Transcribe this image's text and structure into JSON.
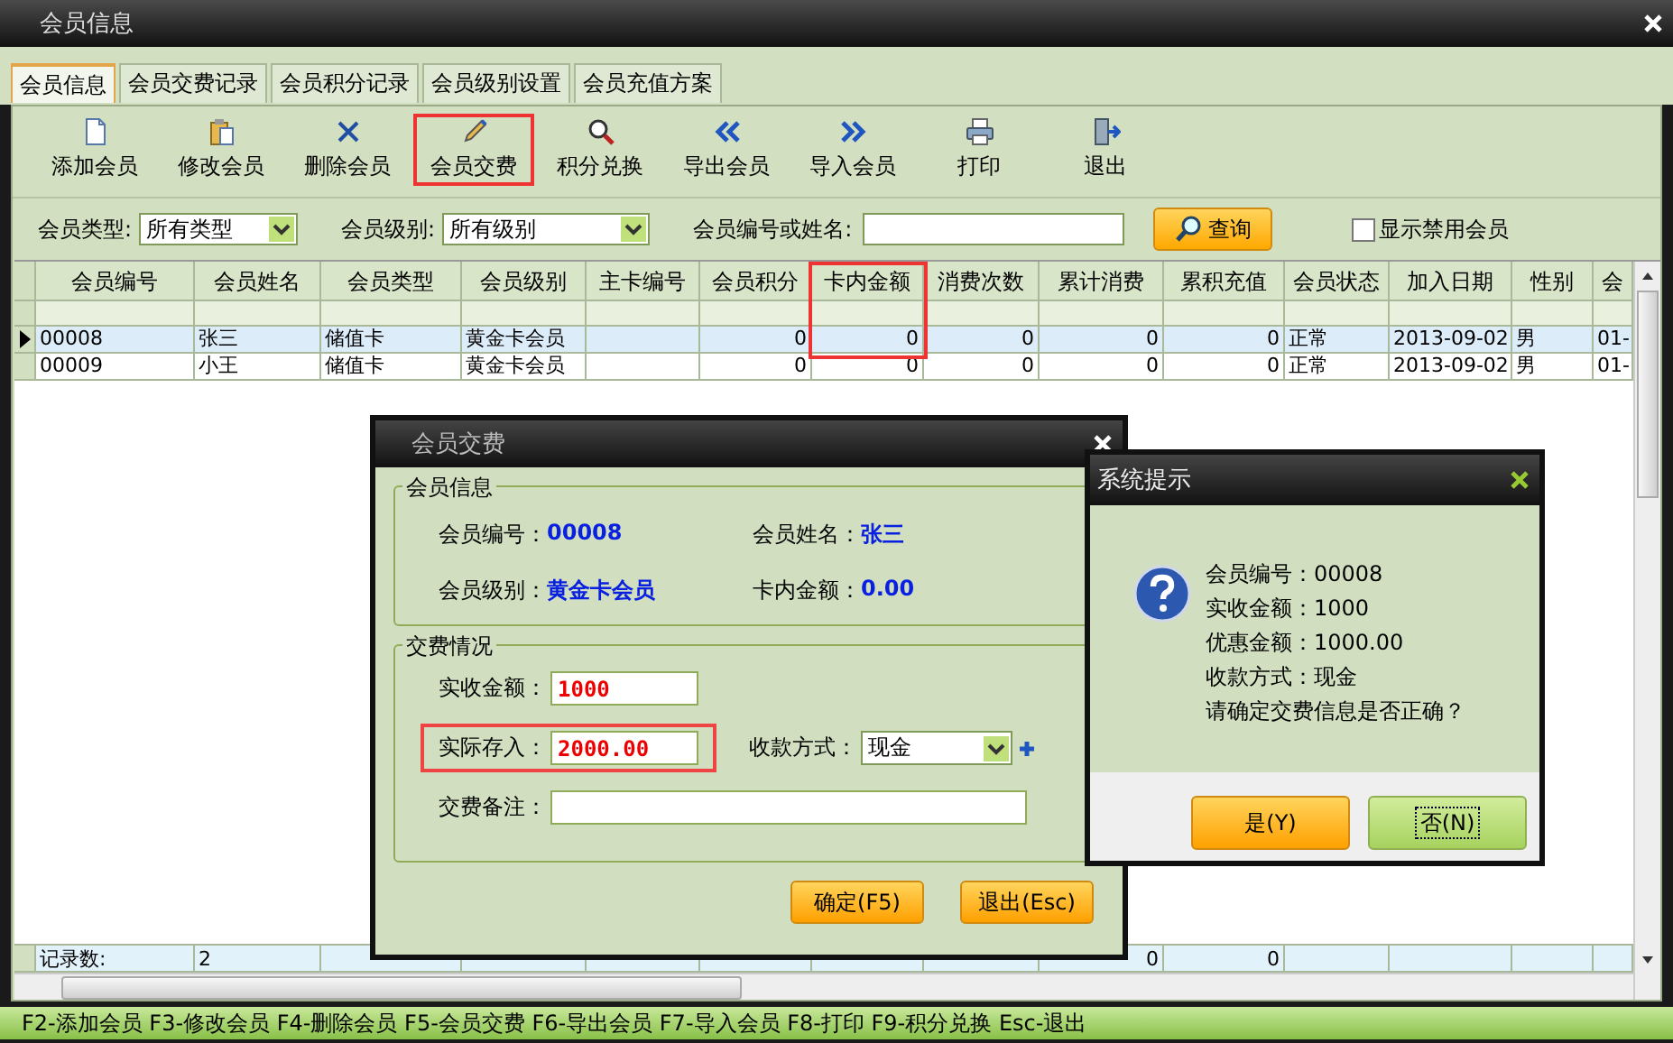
{
  "window": {
    "title": "会员信息"
  },
  "tabs": [
    {
      "label": "会员信息",
      "selected": true
    },
    {
      "label": "会员交费记录",
      "selected": false
    },
    {
      "label": "会员积分记录",
      "selected": false
    },
    {
      "label": "会员级别设置",
      "selected": false
    },
    {
      "label": "会员充值方案",
      "selected": false
    }
  ],
  "toolbar": [
    {
      "label": "添加会员",
      "kind": "add",
      "highlighted": false
    },
    {
      "label": "修改会员",
      "kind": "edit",
      "highlighted": false
    },
    {
      "label": "删除会员",
      "kind": "delete",
      "highlighted": false
    },
    {
      "label": "会员交费",
      "kind": "pay",
      "highlighted": true
    },
    {
      "label": "积分兑换",
      "kind": "search",
      "highlighted": false
    },
    {
      "label": "导出会员",
      "kind": "export",
      "highlighted": false
    },
    {
      "label": "导入会员",
      "kind": "import",
      "highlighted": false
    },
    {
      "label": "打印",
      "kind": "print",
      "highlighted": false
    },
    {
      "label": "退出",
      "kind": "exit",
      "highlighted": false
    }
  ],
  "filters": {
    "member_type": {
      "label": "会员类型:",
      "value": "所有类型"
    },
    "member_level": {
      "label": "会员级别:",
      "value": "所有级别"
    },
    "search": {
      "label": "会员编号或姓名:"
    },
    "query_button": "查询",
    "show_disabled": {
      "label": "显示禁用会员",
      "checked": false
    }
  },
  "table": {
    "columns": [
      {
        "label": "会员编号",
        "kind": "text",
        "highlighted": false,
        "footer": "记录数:"
      },
      {
        "label": "会员姓名",
        "kind": "text",
        "highlighted": false,
        "footer": "2"
      },
      {
        "label": "会员类型",
        "kind": "text",
        "highlighted": false
      },
      {
        "label": "会员级别",
        "kind": "text",
        "highlighted": false
      },
      {
        "label": "主卡编号",
        "kind": "text",
        "highlighted": false
      },
      {
        "label": "会员积分",
        "kind": "number",
        "highlighted": false
      },
      {
        "label": "卡内金额",
        "kind": "number",
        "highlighted": true
      },
      {
        "label": "消费次数",
        "kind": "number",
        "highlighted": false
      },
      {
        "label": "累计消费",
        "kind": "number",
        "highlighted": false,
        "footer": "0"
      },
      {
        "label": "累积充值",
        "kind": "number",
        "highlighted": false,
        "footer": "0"
      },
      {
        "label": "会员状态",
        "kind": "text",
        "highlighted": false
      },
      {
        "label": "加入日期",
        "kind": "text",
        "highlighted": false
      },
      {
        "label": "性别",
        "kind": "text",
        "highlighted": false
      },
      {
        "label": "会",
        "kind": "text",
        "highlighted": false
      }
    ],
    "rows": [
      {
        "selected": true,
        "cells": [
          "00008",
          "张三",
          "储值卡",
          "黄金卡会员",
          null,
          "0",
          "0",
          "0",
          "0",
          "0",
          "正常",
          "2013-09-02",
          "男",
          "01-"
        ]
      },
      {
        "selected": false,
        "cells": [
          "00009",
          "小王",
          "储值卡",
          "黄金卡会员",
          null,
          "0",
          "0",
          "0",
          "0",
          "0",
          "正常",
          "2013-09-02",
          "男",
          "01-"
        ]
      }
    ]
  },
  "status_bar": "F2-添加会员 F3-修改会员 F4-删除会员 F5-会员交费 F6-导出会员 F7-导入会员 F8-打印 F9-积分兑换 Esc-退出",
  "pay_dialog": {
    "title": "会员交费",
    "member_info": {
      "legend": "会员信息",
      "fields": [
        {
          "label": "会员编号：",
          "value": "00008"
        },
        {
          "label": "会员姓名：",
          "value": "张三"
        },
        {
          "label": "会员级别：",
          "value": "黄金卡会员"
        },
        {
          "label": "卡内金额：",
          "value": "0.00"
        }
      ]
    },
    "payment": {
      "legend": "交费情况",
      "received": {
        "label": "实收金额：",
        "value": "1000"
      },
      "deposit": {
        "label": "实际存入：",
        "value": "2000.00",
        "highlighted": true
      },
      "method": {
        "label": "收款方式：",
        "value": "现金"
      },
      "note": {
        "label": "交费备注："
      }
    },
    "buttons": [
      "确定(F5)",
      "退出(Esc)"
    ]
  },
  "confirm_dialog": {
    "title": "系统提示",
    "lines": [
      "会员编号：00008",
      "实收金额：1000",
      "优惠金额：1000.00",
      "收款方式：现金",
      "请确定交费信息是否正确？"
    ],
    "buttons": [
      {
        "label": "是(Y)",
        "kind": "primary",
        "focused": false
      },
      {
        "label": "否(N)",
        "kind": "secondary",
        "focused": true
      }
    ]
  }
}
